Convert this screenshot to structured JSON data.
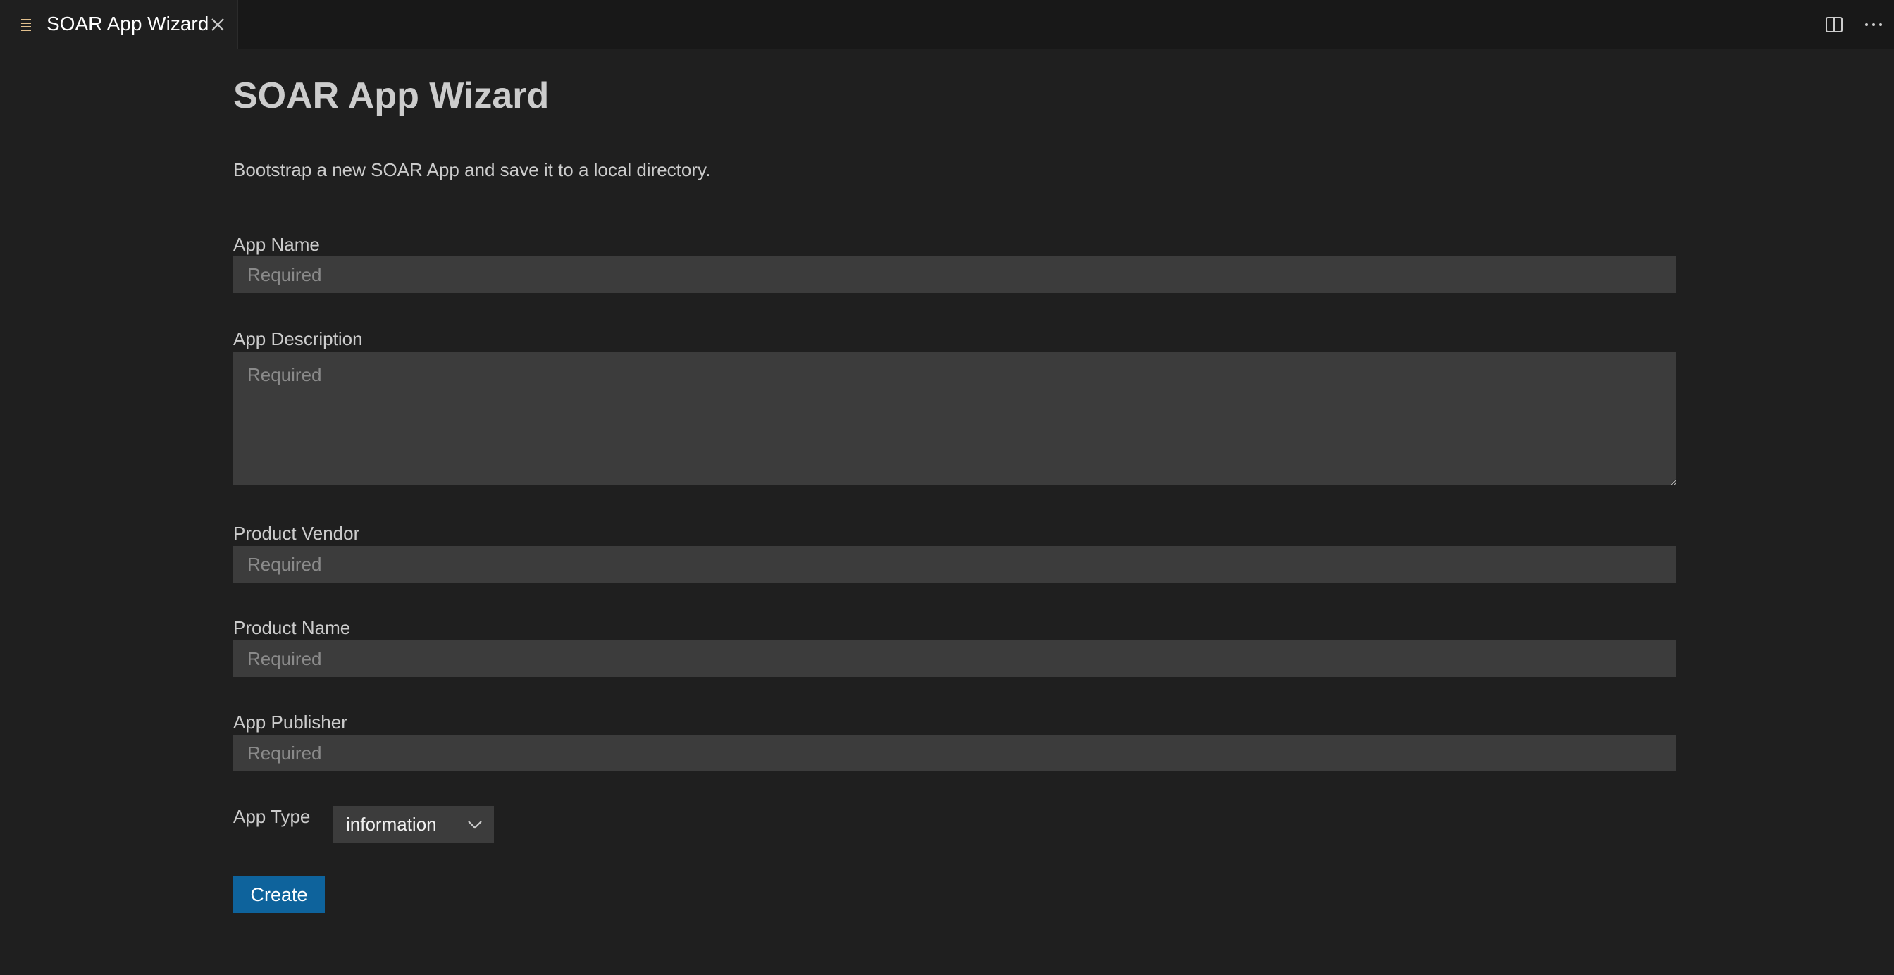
{
  "tab": {
    "title": "SOAR App Wizard",
    "icon": "preview-lines-icon",
    "close_icon": "close-icon"
  },
  "editor_actions": [
    {
      "icon": "split-editor-icon"
    },
    {
      "icon": "more-actions-icon"
    }
  ],
  "page": {
    "title": "SOAR App Wizard",
    "description": "Bootstrap a new SOAR App and save it to a local directory."
  },
  "form": {
    "app_name": {
      "label": "App Name",
      "placeholder": "Required",
      "value": ""
    },
    "app_description": {
      "label": "App Description",
      "placeholder": "Required",
      "value": ""
    },
    "product_vendor": {
      "label": "Product Vendor",
      "placeholder": "Required",
      "value": ""
    },
    "product_name": {
      "label": "Product Name",
      "placeholder": "Required",
      "value": ""
    },
    "app_publisher": {
      "label": "App Publisher",
      "placeholder": "Required",
      "value": ""
    },
    "app_type": {
      "label": "App Type",
      "selected": "information"
    }
  },
  "create_button": {
    "label": "Create"
  },
  "colors": {
    "background": "#1f1f1f",
    "input_background": "#3c3c3c",
    "button_background": "#0e639c",
    "tab_icon": "#e2c08d"
  }
}
